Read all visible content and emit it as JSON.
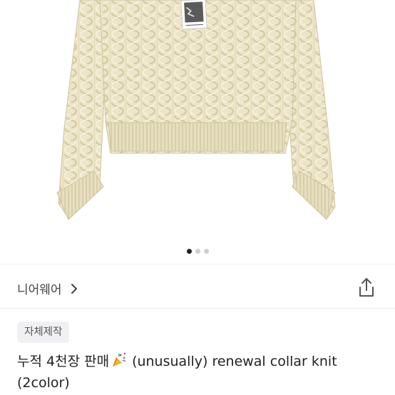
{
  "gallery": {
    "image_alt": "Cream cable-knit cropped sweater product photo",
    "slide_count": 3,
    "active_slide": 1
  },
  "shop": {
    "name": "니어웨어",
    "chevron_icon": "chevron-right-icon",
    "share_icon": "share-icon"
  },
  "product": {
    "tag": "자체제작",
    "title_prefix": "누적 4천장 판매",
    "title_emoji": "party-popper",
    "title_suffix": "(unusually) renewal collar knit",
    "title_line2": "(2color)"
  },
  "colors": {
    "sweater": "#ece5c8",
    "sweater_shadow": "#d6cca6",
    "dot_active": "#222222",
    "dot_inactive": "#cfcfcf",
    "tag_bg": "#f1f1f3"
  }
}
